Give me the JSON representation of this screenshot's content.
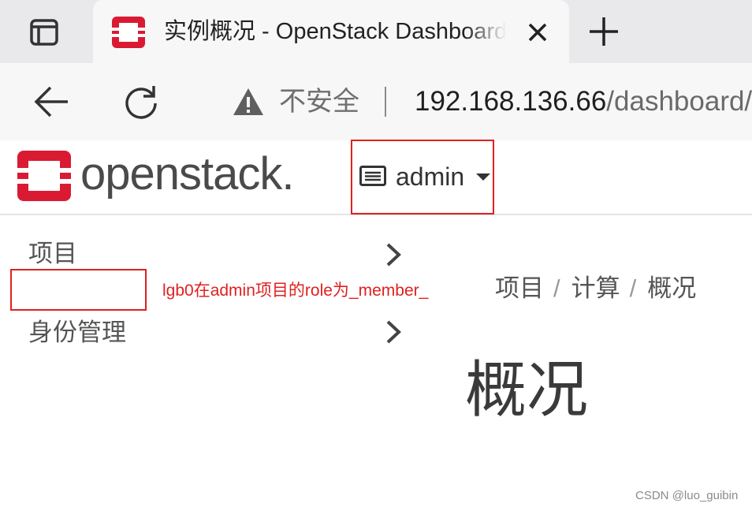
{
  "browser": {
    "tab": {
      "title": "实例概况 - OpenStack Dashboard",
      "favicon": "openstack-logo-icon",
      "close_icon": "close-icon"
    },
    "new_tab_icon": "plus-icon",
    "tab_overview_icon": "window-icon",
    "nav": {
      "back_icon": "arrow-left-icon",
      "reload_icon": "reload-icon"
    },
    "address_bar": {
      "security_icon": "warning-icon",
      "security_label": "不安全",
      "separator": "|",
      "url_host": "192.168.136.66",
      "url_path": "/dashboard/"
    }
  },
  "header": {
    "logo_text": "openstack",
    "logo_dot": ".",
    "project_picker": {
      "icon": "project-list-icon",
      "label": "admin"
    }
  },
  "sidebar": {
    "items": [
      {
        "label": "项目",
        "icon": "chevron-right-icon"
      },
      {
        "label": "身份管理",
        "icon": "chevron-right-icon"
      }
    ]
  },
  "breadcrumb": {
    "items": [
      "项目",
      "计算",
      "概况"
    ],
    "separator": "/"
  },
  "page": {
    "title": "概况"
  },
  "annotation": {
    "note": "lgb0在admin项目的role为_member_",
    "color": "#e02020"
  },
  "watermark": "CSDN @luo_guibin",
  "colors": {
    "brand_red": "#da1a32",
    "annotation_red": "#e02020"
  }
}
